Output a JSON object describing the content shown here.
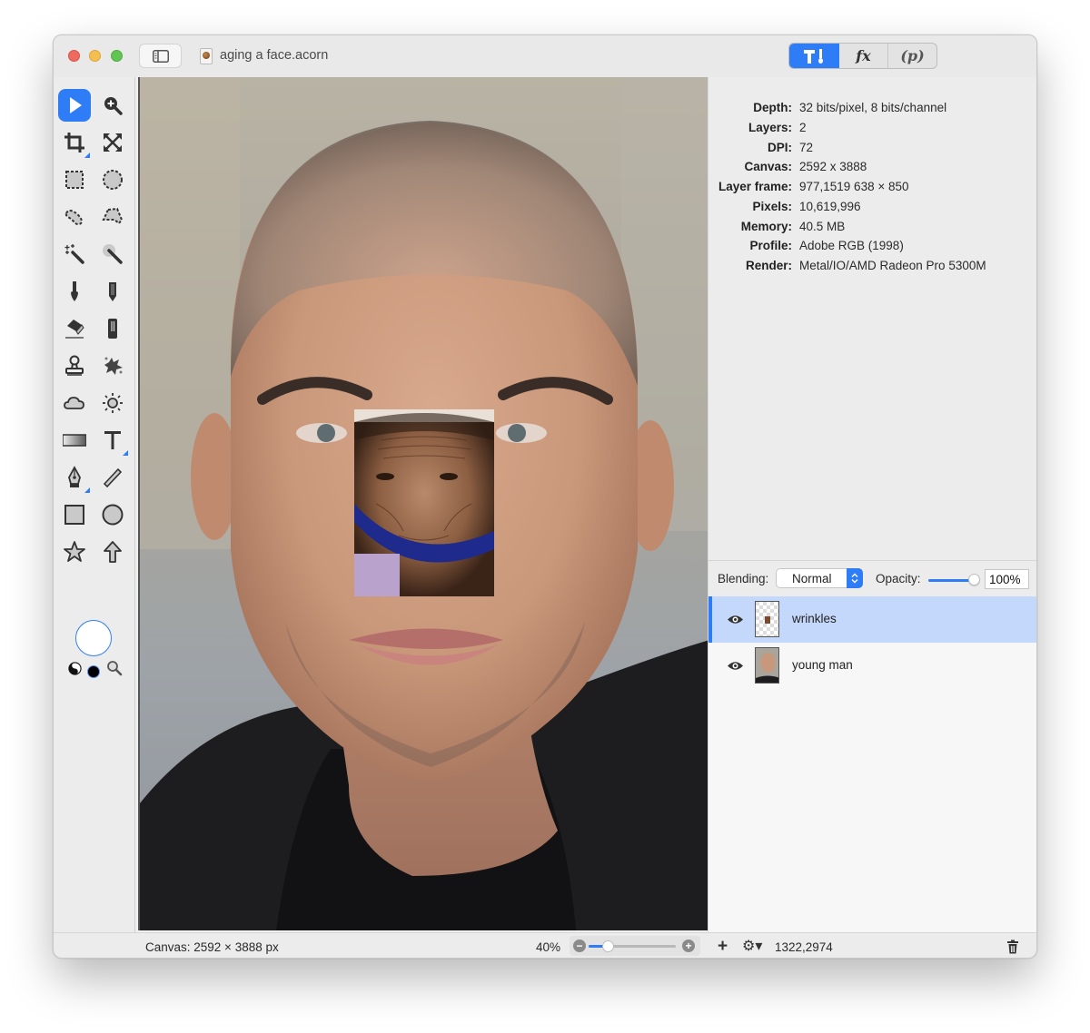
{
  "window": {
    "title": "aging a face.acorn",
    "palette_tabs": [
      {
        "id": "tools",
        "label": "T!",
        "icon": "hammer-brush-icon",
        "active": true
      },
      {
        "id": "filters",
        "label": "fx",
        "icon": "fx-icon",
        "active": false
      },
      {
        "id": "plugins",
        "label": "(p)",
        "icon": "plugin-icon",
        "active": false
      }
    ]
  },
  "toolbar": {
    "tools": [
      {
        "name": "select",
        "icon": "arrow-pointer-icon",
        "active": true
      },
      {
        "name": "zoom",
        "icon": "magnifier-plus-icon"
      },
      {
        "name": "crop",
        "icon": "crop-icon"
      },
      {
        "name": "transform",
        "icon": "expand-arrows-icon"
      },
      {
        "name": "rect-select",
        "icon": "marquee-rect-icon"
      },
      {
        "name": "ellipse-select",
        "icon": "marquee-ellipse-icon"
      },
      {
        "name": "lasso",
        "icon": "lasso-icon"
      },
      {
        "name": "polygon-lasso",
        "icon": "polygon-lasso-icon"
      },
      {
        "name": "magic-wand",
        "icon": "magic-wand-icon"
      },
      {
        "name": "instant-alpha",
        "icon": "instant-alpha-icon"
      },
      {
        "name": "brush",
        "icon": "brush-icon"
      },
      {
        "name": "pencil",
        "icon": "pencil-icon"
      },
      {
        "name": "eraser",
        "icon": "eraser-icon"
      },
      {
        "name": "smudge",
        "icon": "bucket-icon"
      },
      {
        "name": "clone",
        "icon": "stamp-icon"
      },
      {
        "name": "effects-brush",
        "icon": "splatter-icon"
      },
      {
        "name": "burn",
        "icon": "cloud-icon"
      },
      {
        "name": "dodge",
        "icon": "sun-icon"
      },
      {
        "name": "gradient",
        "icon": "gradient-icon"
      },
      {
        "name": "text",
        "icon": "text-icon"
      },
      {
        "name": "bezier",
        "icon": "pen-nib-icon"
      },
      {
        "name": "line",
        "icon": "line-icon"
      },
      {
        "name": "rectangle",
        "icon": "rectangle-icon"
      },
      {
        "name": "oval",
        "icon": "circle-icon"
      },
      {
        "name": "star",
        "icon": "star-icon"
      },
      {
        "name": "arrow",
        "icon": "arrow-up-icon"
      }
    ],
    "stroke_color": "#ffffff",
    "fill_color": "#000000"
  },
  "info": [
    {
      "key": "Depth:",
      "value": "32 bits/pixel, 8 bits/channel"
    },
    {
      "key": "Layers:",
      "value": "2"
    },
    {
      "key": "DPI:",
      "value": "72"
    },
    {
      "key": "Canvas:",
      "value": "2592 x 3888"
    },
    {
      "key": "Layer frame:",
      "value": "977,1519 638 × 850"
    },
    {
      "key": "Pixels:",
      "value": "10,619,996"
    },
    {
      "key": "Memory:",
      "value": "40.5 MB"
    },
    {
      "key": "Profile:",
      "value": "Adobe RGB (1998)"
    },
    {
      "key": "Render:",
      "value": "Metal/IO/AMD Radeon Pro 5300M"
    }
  ],
  "layer_controls": {
    "blending_label": "Blending:",
    "blending_value": "Normal",
    "opacity_label": "Opacity:",
    "opacity_value": "100%",
    "opacity_fraction": 1.0
  },
  "layers": [
    {
      "name": "wrinkles",
      "visible": true,
      "selected": true
    },
    {
      "name": "young man",
      "visible": true,
      "selected": false
    }
  ],
  "status": {
    "canvas_size": "Canvas: 2592 × 3888 px",
    "zoom_percent": "40%",
    "zoom_slider_fraction": 0.22,
    "coordinates": "1322,2974",
    "add_label": "+",
    "gear_label": "⚙▾"
  },
  "colors": {
    "accent": "#2f7df6",
    "selected_row": "#c4d8fb"
  }
}
